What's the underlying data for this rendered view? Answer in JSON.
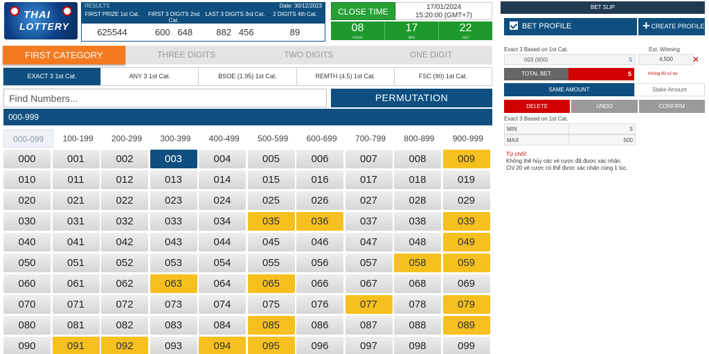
{
  "logo": {
    "line1": "THAI",
    "line2": "LOTTERY"
  },
  "results": {
    "title": "RESULTS",
    "date": "Date: 30/12/2023",
    "columns": [
      "FIRST PRIZE 1st Cat.",
      "FIRST 3 DIGITS 2nd Cat.",
      "LAST 3 DIGITS 3rd Cat.",
      "2 DIGITS 4th Cat."
    ],
    "values": [
      "625544",
      "600   648",
      "882   456",
      "89"
    ]
  },
  "close_time": {
    "label": "CLOSE TIME",
    "date": "17/01/2024",
    "time": "15:20:00 (GMT+7)"
  },
  "countdown": [
    {
      "value": "08",
      "unit": "HOUR"
    },
    {
      "value": "17",
      "unit": "MIN"
    },
    {
      "value": "22",
      "unit": "SEC"
    }
  ],
  "category_tabs": [
    "FIRST CATEGORY",
    "THREE DIGITS",
    "TWO DIGITS",
    "ONE DIGIT"
  ],
  "sub_tabs": [
    "EXACT 3 1st Cat.",
    "ANY 3 1st Cat.",
    "BSOE (1.95) 1st Cat.",
    "REMTH (4.5) 1st Cat.",
    "FSC (90) 1st Cat."
  ],
  "search": {
    "placeholder": "Find Numbers...",
    "value": ""
  },
  "permutation_label": "PERMUTATION",
  "range_label": "000-999",
  "sub_ranges": [
    "000-099",
    "100-199",
    "200-299",
    "300-399",
    "400-499",
    "500-599",
    "600-699",
    "700-799",
    "800-899",
    "900-999"
  ],
  "selected_number": "003",
  "highlighted_numbers": [
    "009",
    "035",
    "036",
    "039",
    "049",
    "058",
    "059",
    "063",
    "065",
    "077",
    "079",
    "085",
    "089",
    "091",
    "092",
    "094",
    "095"
  ],
  "bet_slip": {
    "title": "BET SLIP",
    "bet_profile": "BET PROFILE",
    "create_profile": "CREATE PROFILE",
    "bet_type": "Exact 3 Based on 1st Cat.",
    "est_winning_label": "Est. Winning",
    "bet_number": "003 (900)",
    "bet_amount": "5",
    "est_winning": "4,500",
    "remove": "✕",
    "total_bet_label": "TOTAL BET",
    "total_bet": "5",
    "total_msg": "Không đủ số dư",
    "same_amount": "SAME AMOUNT",
    "stake_amount": "Stake Amount",
    "delete": "DELETE",
    "undo": "UNDO",
    "confirm": "CONFIRM",
    "limits_title": "Exact 3 Based on 1st Cat.",
    "min_label": "MIN",
    "min_value": "5",
    "max_label": "MAX",
    "max_value": "500",
    "warning_title": "Từ chối!",
    "warning_line1": "Không thể hủy các vé cược đã được xác nhận.",
    "warning_line2": "Chỉ 20 vé cược có thể được xác nhận cùng 1 lúc."
  },
  "colors": {
    "primary": "#0e4f7f",
    "orange": "#f47a20",
    "green": "#27a135",
    "yellow": "#f5c020",
    "red": "#d10000"
  }
}
